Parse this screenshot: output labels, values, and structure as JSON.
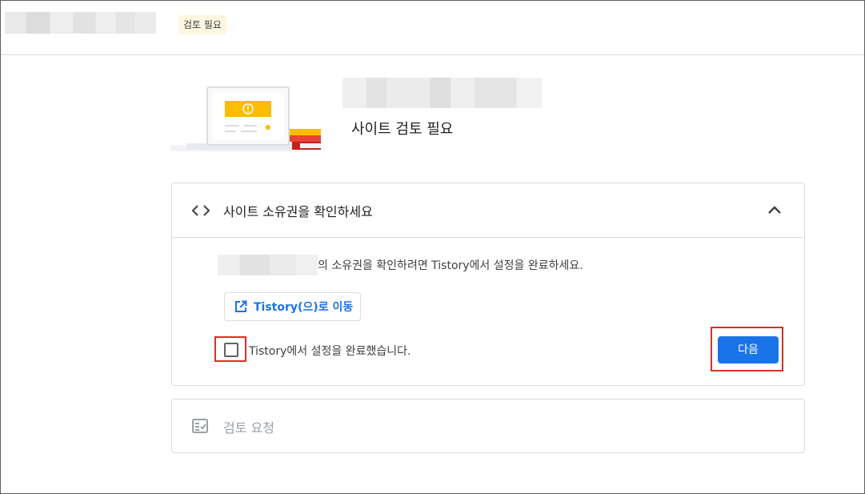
{
  "header": {
    "badge_label": "검토 필요"
  },
  "hero": {
    "title": "사이트 검토 필요"
  },
  "step_ownership": {
    "title": "사이트 소유권을 확인하세요",
    "instruction": "의 소유권을 확인하려면 Tistory에서 설정을 완료하세요.",
    "goto_button_label": "Tistory(으)로 이동",
    "checkbox_label": "Tistory에서 설정을 완료했습니다.",
    "checkbox_checked": false,
    "next_button_label": "다음"
  },
  "step_review": {
    "title": "검토 요청"
  },
  "colors": {
    "accent": "#1a73e8",
    "highlight": "#d93025",
    "badge_bg": "#fef7e0",
    "illustration_yellow": "#fbbc04"
  },
  "icons": {
    "code": "code-icon",
    "expand": "chevron-up-icon",
    "open_external": "open-in-new-icon",
    "review": "fact-check-icon"
  }
}
